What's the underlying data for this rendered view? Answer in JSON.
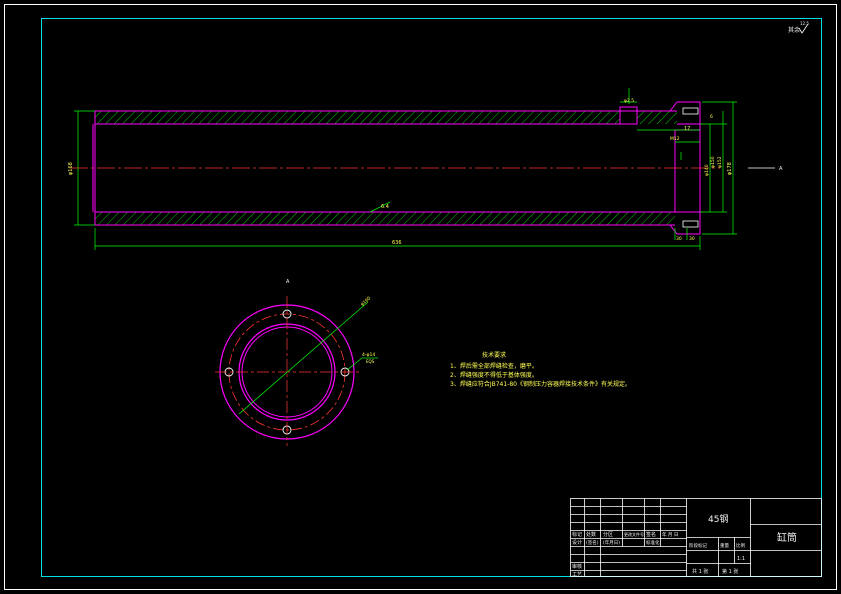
{
  "sheet": {
    "roughness_note": "其余",
    "roughness_value": "12.5"
  },
  "section_label": "A",
  "dims": {
    "overall_length": "636",
    "outer_dia": "φ168",
    "right_dia": "φ178",
    "bore_right_a": "φ140",
    "bore_right_b": "φ150",
    "bore_right_c": "φ152",
    "roughness_mid": "6.4",
    "left_step": "17",
    "small_box": "φ2.5",
    "mid_hole": "M12",
    "step_a": "30",
    "step_b": "30",
    "right_top": "6",
    "bolt_circle": "φ160",
    "holes": "4-φ14",
    "holes_b": "EQS"
  },
  "notes": {
    "title": "技术要求",
    "items": [
      "1、焊后需全部焊缝检查，磨平。",
      "2、焊缝强度不得低于基体强度。",
      "3、焊缝应符合JB741-80《钢制压力容器焊接技术条件》有关规定。"
    ]
  },
  "title_block": {
    "part_name": "缸筒",
    "material": "45钢",
    "row1": [
      "标记",
      "处数",
      "分区",
      "更改文件号",
      "签名",
      "年 月 日"
    ],
    "row2": [
      "设计",
      "(签名)",
      "(年月日)",
      "标准化"
    ],
    "mass_label": "阶段标记",
    "weight_label": "重量",
    "scale_label": "比例",
    "scale_value": "1:1",
    "audit": "审核",
    "process": "工艺",
    "sheet_count": "共 1 张",
    "sheet_no": "第 1 张"
  },
  "colors": {
    "frame": "#00e0e0",
    "outline": "#ff00ff",
    "center": "#ff3333",
    "dimension": "#00ff00",
    "hatch": "#00c800",
    "text": "#ffffff",
    "note": "#ffff55"
  }
}
